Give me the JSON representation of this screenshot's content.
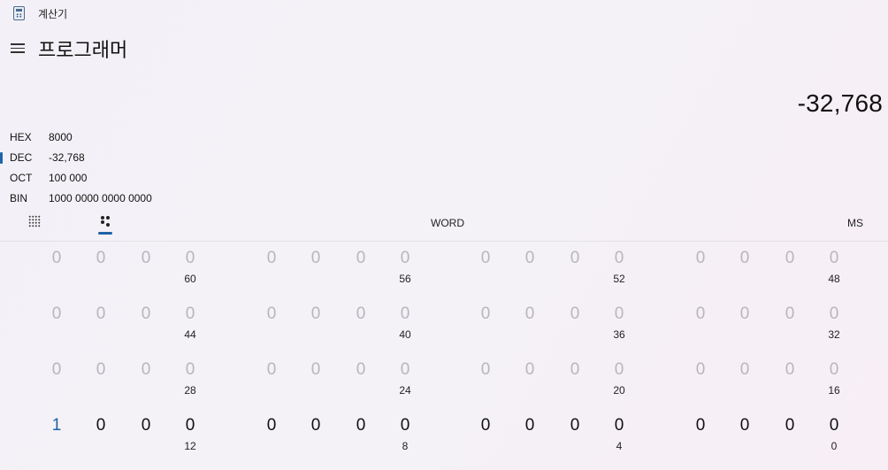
{
  "window": {
    "title": "계산기"
  },
  "header": {
    "mode_title": "프로그래머"
  },
  "display": {
    "value": "-32,768"
  },
  "radix": [
    {
      "label": "HEX",
      "value": "8000",
      "active": false
    },
    {
      "label": "DEC",
      "value": "-32,768",
      "active": true
    },
    {
      "label": "OCT",
      "value": "100 000",
      "active": false
    },
    {
      "label": "BIN",
      "value": "1000 0000 0000 0000",
      "active": false
    }
  ],
  "toolbar": {
    "word_label": "WORD",
    "ms_label": "MS"
  },
  "bit_rows": [
    {
      "bits": [
        "0",
        "0",
        "0",
        "0",
        "0",
        "0",
        "0",
        "0",
        "0",
        "0",
        "0",
        "0",
        "0",
        "0",
        "0",
        "0"
      ],
      "positions": [
        "60",
        "56",
        "52",
        "48"
      ],
      "enabled": false
    },
    {
      "bits": [
        "0",
        "0",
        "0",
        "0",
        "0",
        "0",
        "0",
        "0",
        "0",
        "0",
        "0",
        "0",
        "0",
        "0",
        "0",
        "0"
      ],
      "positions": [
        "44",
        "40",
        "36",
        "32"
      ],
      "enabled": false
    },
    {
      "bits": [
        "0",
        "0",
        "0",
        "0",
        "0",
        "0",
        "0",
        "0",
        "0",
        "0",
        "0",
        "0",
        "0",
        "0",
        "0",
        "0"
      ],
      "positions": [
        "28",
        "24",
        "20",
        "16"
      ],
      "enabled": false
    },
    {
      "bits": [
        "1",
        "0",
        "0",
        "0",
        "0",
        "0",
        "0",
        "0",
        "0",
        "0",
        "0",
        "0",
        "0",
        "0",
        "0",
        "0"
      ],
      "positions": [
        "12",
        "8",
        "4",
        "0"
      ],
      "enabled": true
    }
  ],
  "colors": {
    "accent": "#1e63a8",
    "disabled_bit": "#b8b6bc",
    "bit": "#111111"
  }
}
